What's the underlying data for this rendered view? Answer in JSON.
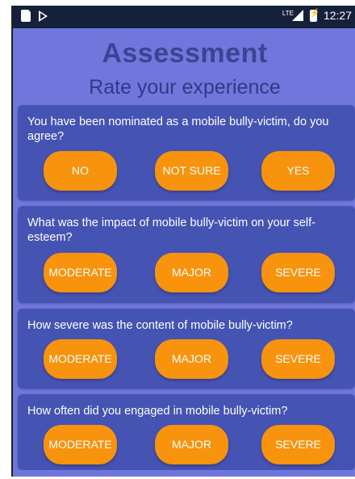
{
  "status_bar": {
    "network": "LTE",
    "time": "12:27",
    "left_icons": [
      "sim-card-icon",
      "play-store-icon"
    ],
    "right_icons": [
      "signal-icon",
      "battery-charging-icon"
    ]
  },
  "header": {
    "title": "Assessment",
    "subtitle": "Rate your experience"
  },
  "questions": [
    {
      "text": "You have been nominated as a mobile bully-victim, do you agree?",
      "options": [
        "NO",
        "NOT SURE",
        "YES"
      ]
    },
    {
      "text": "What was the impact of mobile bully-victim on your self-esteem?",
      "options": [
        "MODERATE",
        "MAJOR",
        "SEVERE"
      ]
    },
    {
      "text": "How severe was the content of mobile bully-victim?",
      "options": [
        "MODERATE",
        "MAJOR",
        "SEVERE"
      ]
    },
    {
      "text": "How often did you engaged in mobile bully-victim?",
      "options": [
        "MODERATE",
        "MAJOR",
        "SEVERE"
      ]
    }
  ],
  "colors": {
    "background": "#6f77dc",
    "card": "#4553b3",
    "button": "#f7930d",
    "title": "#3b4494",
    "status_bar": "#15203a"
  }
}
